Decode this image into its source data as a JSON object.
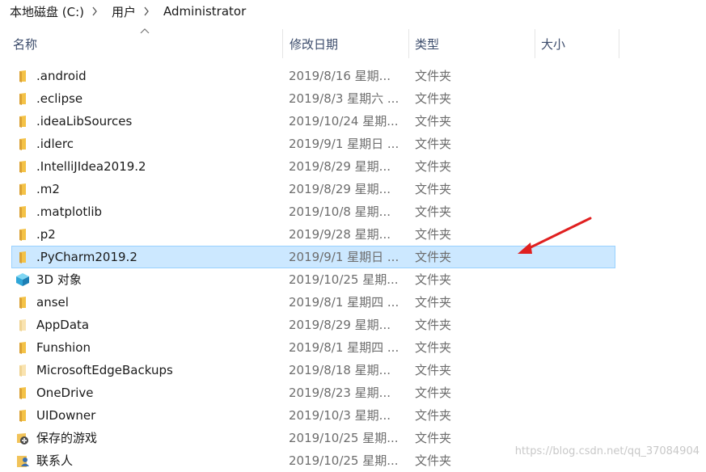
{
  "breadcrumb": {
    "drive": "本地磁盘 (C:)",
    "users": "用户",
    "current": "Administrator"
  },
  "columns": {
    "name": "名称",
    "date": "修改日期",
    "type": "类型",
    "size": "大小"
  },
  "colors": {
    "folder": "#e8b23a",
    "selected_bg": "#cce8ff",
    "selected_border": "#99d1ff",
    "annotation_arrow": "#e02020"
  },
  "rows": [
    {
      "name": ".android",
      "date": "2019/8/16 星期...",
      "type": "文件夹",
      "icon": "folder-icon"
    },
    {
      "name": ".eclipse",
      "date": "2019/8/3 星期六 ...",
      "type": "文件夹",
      "icon": "folder-icon"
    },
    {
      "name": ".ideaLibSources",
      "date": "2019/10/24 星期...",
      "type": "文件夹",
      "icon": "folder-icon"
    },
    {
      "name": ".idlerc",
      "date": "2019/9/1 星期日 ...",
      "type": "文件夹",
      "icon": "folder-icon"
    },
    {
      "name": ".IntelliJIdea2019.2",
      "date": "2019/8/29 星期...",
      "type": "文件夹",
      "icon": "folder-icon"
    },
    {
      "name": ".m2",
      "date": "2019/8/29 星期...",
      "type": "文件夹",
      "icon": "folder-icon"
    },
    {
      "name": ".matplotlib",
      "date": "2019/10/8 星期...",
      "type": "文件夹",
      "icon": "folder-icon"
    },
    {
      "name": ".p2",
      "date": "2019/9/28 星期...",
      "type": "文件夹",
      "icon": "folder-icon"
    },
    {
      "name": ".PyCharm2019.2",
      "date": "2019/9/1 星期日 ...",
      "type": "文件夹",
      "icon": "folder-icon",
      "selected": true
    },
    {
      "name": "3D 对象",
      "date": "2019/10/25 星期...",
      "type": "文件夹",
      "icon": "3d-objects-icon"
    },
    {
      "name": "ansel",
      "date": "2019/8/1 星期四 ...",
      "type": "文件夹",
      "icon": "folder-icon"
    },
    {
      "name": "AppData",
      "date": "2019/8/29 星期...",
      "type": "文件夹",
      "icon": "hidden-folder-icon"
    },
    {
      "name": "Funshion",
      "date": "2019/8/1 星期四 ...",
      "type": "文件夹",
      "icon": "folder-icon"
    },
    {
      "name": "MicrosoftEdgeBackups",
      "date": "2019/8/18 星期...",
      "type": "文件夹",
      "icon": "hidden-folder-icon"
    },
    {
      "name": "OneDrive",
      "date": "2019/8/23 星期...",
      "type": "文件夹",
      "icon": "folder-icon"
    },
    {
      "name": "UIDowner",
      "date": "2019/10/3 星期...",
      "type": "文件夹",
      "icon": "folder-icon"
    },
    {
      "name": "保存的游戏",
      "date": "2019/10/25 星期...",
      "type": "文件夹",
      "icon": "saved-games-icon"
    },
    {
      "name": "联系人",
      "date": "2019/10/25 星期...",
      "type": "文件夹",
      "icon": "contacts-icon"
    }
  ],
  "watermark": "https://blog.csdn.net/qq_37084904"
}
